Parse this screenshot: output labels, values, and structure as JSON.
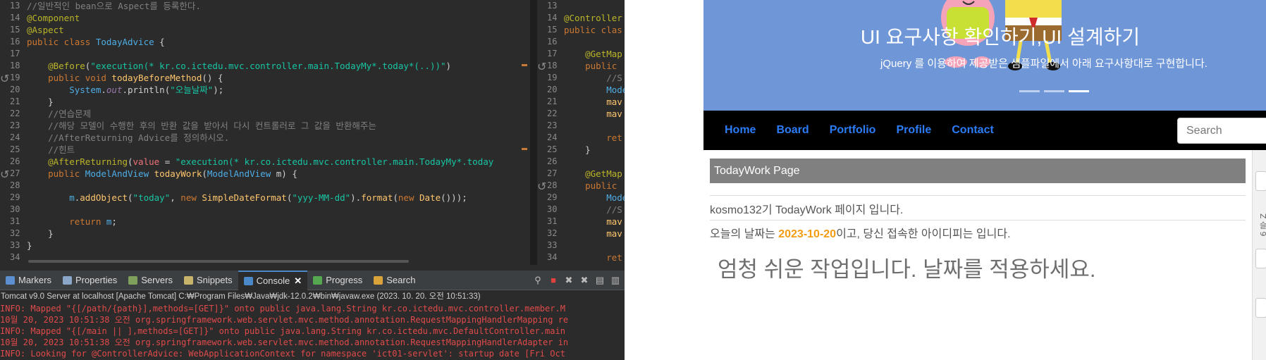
{
  "editor_main": {
    "line_numbers": [
      "13",
      "14",
      "15",
      "16",
      "17",
      "18",
      "19",
      "20",
      "21",
      "22",
      "23",
      "24",
      "25",
      "26",
      "27",
      "28",
      "29",
      "30",
      "31",
      "32",
      "33",
      "34"
    ],
    "lines": [
      [
        [
          "c-comment",
          "//일반적인 bean으로 Aspect를 등록한다."
        ]
      ],
      [
        [
          "c-annot",
          "@Component"
        ]
      ],
      [
        [
          "c-annot",
          "@Aspect"
        ]
      ],
      [
        [
          "c-kw",
          "public class "
        ],
        [
          "c-type",
          "TodayAdvice"
        ],
        [
          "c-plain",
          " {"
        ]
      ],
      [
        [
          "c-plain",
          ""
        ]
      ],
      [
        [
          "c-plain",
          "    "
        ],
        [
          "c-annot",
          "@Before"
        ],
        [
          "c-plain",
          "("
        ],
        [
          "c-strg",
          "\"execution(* kr.co.ictedu.mvc.controller.main.TodayMy*.today*(..))\""
        ],
        [
          "c-plain",
          ")"
        ]
      ],
      [
        [
          "c-kw",
          "    public void "
        ],
        [
          "c-method",
          "todayBeforeMethod"
        ],
        [
          "c-plain",
          "() {"
        ]
      ],
      [
        [
          "c-plain",
          "        "
        ],
        [
          "c-type",
          "System"
        ],
        [
          "c-plain",
          "."
        ],
        [
          "c-field",
          "out"
        ],
        [
          "c-plain",
          ".println("
        ],
        [
          "c-strg",
          "\"오늘날짜\""
        ],
        [
          "c-plain",
          ");"
        ]
      ],
      [
        [
          "c-plain",
          "    }"
        ]
      ],
      [
        [
          "c-comment",
          "    //연습문제"
        ]
      ],
      [
        [
          "c-comment",
          "    //해당 모델이 수행한 후의 반환 값을 받아서 다시 컨트롤러로 그 값을 반환해주는"
        ]
      ],
      [
        [
          "c-comment",
          "    //AfterReturning Advice를 정의하시오."
        ]
      ],
      [
        [
          "c-comment",
          "    //힌트"
        ]
      ],
      [
        [
          "c-plain",
          "    "
        ],
        [
          "c-annot",
          "@AfterReturning"
        ],
        [
          "c-plain",
          "("
        ],
        [
          "c-red",
          "value"
        ],
        [
          "c-plain",
          " = "
        ],
        [
          "c-strg",
          "\"execution(* kr.co.ictedu.mvc.controller.main.TodayMy*.today"
        ]
      ],
      [
        [
          "c-kw",
          "    public "
        ],
        [
          "c-type",
          "ModelAndView "
        ],
        [
          "c-method",
          "todayWork"
        ],
        [
          "c-plain",
          "("
        ],
        [
          "c-type",
          "ModelAndView "
        ],
        [
          "c-plain",
          "m) {"
        ]
      ],
      [
        [
          "c-plain",
          ""
        ]
      ],
      [
        [
          "c-plain",
          "        "
        ],
        [
          "c-type",
          "m"
        ],
        [
          "c-plain",
          "."
        ],
        [
          "c-method",
          "addObject"
        ],
        [
          "c-plain",
          "("
        ],
        [
          "c-strg",
          "\"today\""
        ],
        [
          "c-plain",
          ", "
        ],
        [
          "c-kw",
          "new "
        ],
        [
          "c-method",
          "SimpleDateFormat"
        ],
        [
          "c-plain",
          "("
        ],
        [
          "c-strg",
          "\"yyy-MM-dd\""
        ],
        [
          "c-plain",
          ")."
        ],
        [
          "c-method",
          "format"
        ],
        [
          "c-plain",
          "("
        ],
        [
          "c-kw",
          "new "
        ],
        [
          "c-method",
          "Date"
        ],
        [
          "c-plain",
          "()));"
        ]
      ],
      [
        [
          "c-plain",
          ""
        ]
      ],
      [
        [
          "c-kw",
          "        return "
        ],
        [
          "c-type",
          "m"
        ],
        [
          "c-plain",
          ";"
        ]
      ],
      [
        [
          "c-plain",
          "    }"
        ]
      ],
      [
        [
          "c-plain",
          "}"
        ]
      ],
      [
        [
          "c-plain",
          ""
        ]
      ]
    ]
  },
  "editor_second": {
    "line_numbers": [
      "13",
      "14",
      "15",
      "16",
      "17",
      "18",
      "19",
      "20",
      "21",
      "22",
      "23",
      "24",
      "25",
      "26",
      "27",
      "28",
      "29",
      "30",
      "31",
      "32",
      "33",
      "34"
    ],
    "lines": [
      [
        [
          "c-plain",
          ""
        ]
      ],
      [
        [
          "c-annot",
          "@Controller"
        ]
      ],
      [
        [
          "c-kw",
          "public clas"
        ]
      ],
      [
        [
          "c-plain",
          ""
        ]
      ],
      [
        [
          "c-plain",
          "    "
        ],
        [
          "c-annot",
          "@GetMap"
        ]
      ],
      [
        [
          "c-kw",
          "    public "
        ]
      ],
      [
        [
          "c-comment",
          "        //S"
        ]
      ],
      [
        [
          "c-type",
          "        Mode"
        ]
      ],
      [
        [
          "c-method",
          "        mav"
        ]
      ],
      [
        [
          "c-method",
          "        mav"
        ]
      ],
      [
        [
          "c-plain",
          ""
        ]
      ],
      [
        [
          "c-kw",
          "        ret"
        ]
      ],
      [
        [
          "c-plain",
          "    }"
        ]
      ],
      [
        [
          "c-plain",
          ""
        ]
      ],
      [
        [
          "c-plain",
          "    "
        ],
        [
          "c-annot",
          "@GetMap"
        ]
      ],
      [
        [
          "c-kw",
          "    public "
        ]
      ],
      [
        [
          "c-type",
          "        Mode"
        ]
      ],
      [
        [
          "c-comment",
          "        //S"
        ]
      ],
      [
        [
          "c-method",
          "        mav"
        ]
      ],
      [
        [
          "c-method",
          "        mav"
        ]
      ],
      [
        [
          "c-plain",
          ""
        ]
      ],
      [
        [
          "c-kw",
          "        ret"
        ]
      ]
    ]
  },
  "console": {
    "tabs": [
      {
        "label": "Markers",
        "icon": "markers-icon",
        "color": "#5b8fd0"
      },
      {
        "label": "Properties",
        "icon": "properties-icon",
        "color": "#8aa6c8"
      },
      {
        "label": "Servers",
        "icon": "servers-icon",
        "color": "#7fa05a"
      },
      {
        "label": "Snippets",
        "icon": "snippets-icon",
        "color": "#c7b46a"
      },
      {
        "label": "Console",
        "icon": "console-icon",
        "color": "#4a88c7",
        "active": true
      },
      {
        "label": "Progress",
        "icon": "progress-icon",
        "color": "#55a84f"
      },
      {
        "label": "Search",
        "icon": "search-icon",
        "color": "#d9a33a"
      }
    ],
    "title": "Tomcat v9.0 Server at localhost [Apache Tomcat] C:₩Program Files₩Java₩jdk-12.0.2₩bin₩javaw.exe  (2023. 10. 20. 오전 10:51:33)",
    "lines": [
      "INFO: Mapped \"{[/path/{path}],methods=[GET]}\" onto public java.lang.String kr.co.ictedu.mvc.controller.member.M",
      "10월 20, 2023 10:51:38 오전 org.springframework.web.servlet.mvc.method.annotation.RequestMappingHandlerMapping re",
      "INFO: Mapped \"{[/main || ],methods=[GET]}\" onto public java.lang.String kr.co.ictedu.mvc.DefaultController.main",
      "10월 20, 2023 10:51:38 오전 org.springframework.web.servlet.mvc.method.annotation.RequestMappingHandlerAdapter in",
      "INFO: Looking for @ControllerAdvice: WebApplicationContext for namespace 'ict01-servlet': startup date [Fri Oct"
    ]
  },
  "browser": {
    "hero_title": "UI 요구사항 확인하기,UI 설계하기",
    "hero_sub": "jQuery 를 이용하여 제공받은 샘플파일에서 아래 요구사항대로 구현합니다.",
    "nav": [
      "Home",
      "Board",
      "Portfolio",
      "Profile",
      "Contact"
    ],
    "search_placeholder": "Search",
    "page_head": "TodayWork Page",
    "intro": "kosmo132기 TodayWork 페이지 입니다.",
    "date_prefix": "오늘의 날짜는 ",
    "date_value": "2023-10-20",
    "date_suffix": "이고, 당신 접속한 아이디피는 입니다.",
    "big_text": "엄청 쉬운 작업입니다. 날짜를 적용하세요.",
    "side_text": "Z 슬 9"
  }
}
